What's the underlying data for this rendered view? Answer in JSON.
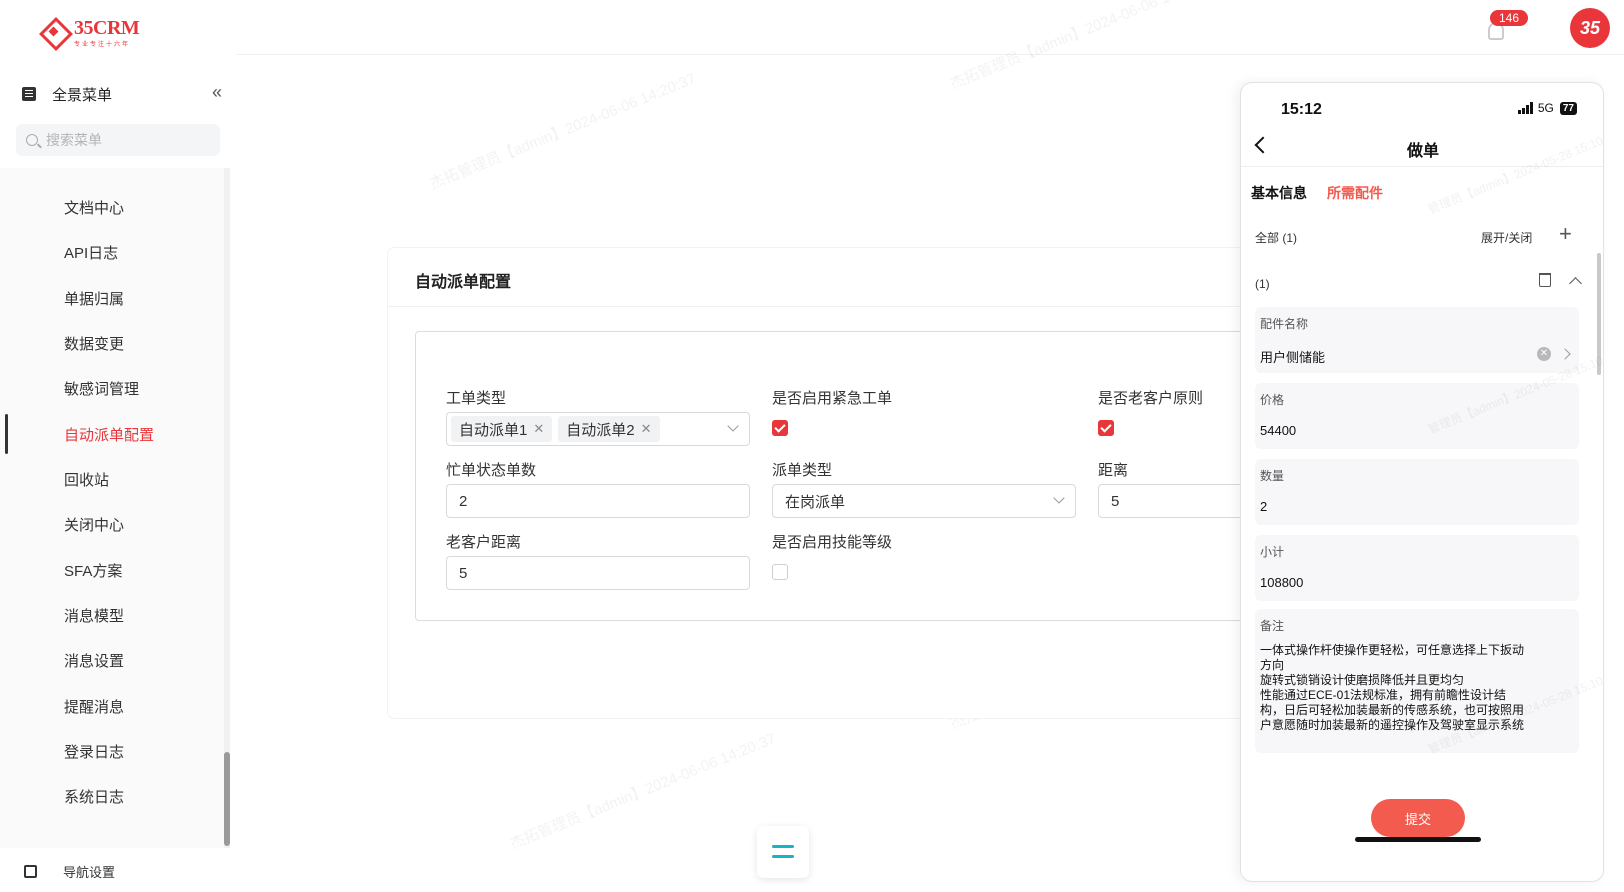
{
  "brand": {
    "name": "35CRM",
    "tagline": "专业专注十六年",
    "accent": "#e8363a"
  },
  "sidebar": {
    "title": "全景菜单",
    "search_placeholder": "搜索菜单",
    "items": [
      {
        "label": "文档中心"
      },
      {
        "label": "API日志"
      },
      {
        "label": "单据归属"
      },
      {
        "label": "数据变更"
      },
      {
        "label": "敏感词管理"
      },
      {
        "label": "自动派单配置",
        "active": true
      },
      {
        "label": "回收站"
      },
      {
        "label": "关闭中心"
      },
      {
        "label": "SFA方案"
      },
      {
        "label": "消息模型"
      },
      {
        "label": "消息设置"
      },
      {
        "label": "提醒消息"
      },
      {
        "label": "登录日志"
      },
      {
        "label": "系统日志"
      }
    ],
    "footer": "导航设置"
  },
  "header": {
    "notification_count": "146",
    "avatar_text": "35"
  },
  "card": {
    "title": "自动派单配置",
    "fields": {
      "order_type": {
        "label": "工单类型",
        "tags": [
          "自动派单1",
          "自动派单2"
        ]
      },
      "urgent": {
        "label": "是否启用紧急工单",
        "checked": true
      },
      "old_customer": {
        "label": "是否老客户原则",
        "checked": true
      },
      "busy_count": {
        "label": "忙单状态单数",
        "value": "2"
      },
      "dispatch_type": {
        "label": "派单类型",
        "value": "在岗派单"
      },
      "distance": {
        "label": "距离",
        "value": "5"
      },
      "old_distance": {
        "label": "老客户距离",
        "value": "5"
      },
      "skill_level": {
        "label": "是否启用技能等级",
        "checked": false
      }
    }
  },
  "watermark": "杰拓管理员【admin】2024-06-06 14:20:37",
  "phone": {
    "time": "15:12",
    "network": "5G",
    "battery": "77",
    "title": "做单",
    "tabs": [
      {
        "label": "基本信息"
      },
      {
        "label": "所需配件",
        "active": true
      }
    ],
    "all_label": "全部 (1)",
    "toggle_label": "展开/关闭",
    "item_index": "(1)",
    "fields": [
      {
        "label": "配件名称",
        "value": "用户侧储能"
      },
      {
        "label": "价格",
        "value": "54400"
      },
      {
        "label": "数量",
        "value": "2"
      },
      {
        "label": "小计",
        "value": "108800"
      }
    ],
    "remark": {
      "label": "备注",
      "value": "一体式操作杆使操作更轻松，可任意选择上下扳动方向\n旋转式锁销设计使磨损降低并且更均匀\n性能通过ECE-01法规标准，拥有前瞻性设计结构，日后可轻松加装最新的传感系统，也可按照用户意愿随时加装最新的遥控操作及驾驶室显示系统"
    },
    "submit_label": "提交",
    "watermark": "管理员【admin】2024-05-28 15:10:31"
  }
}
